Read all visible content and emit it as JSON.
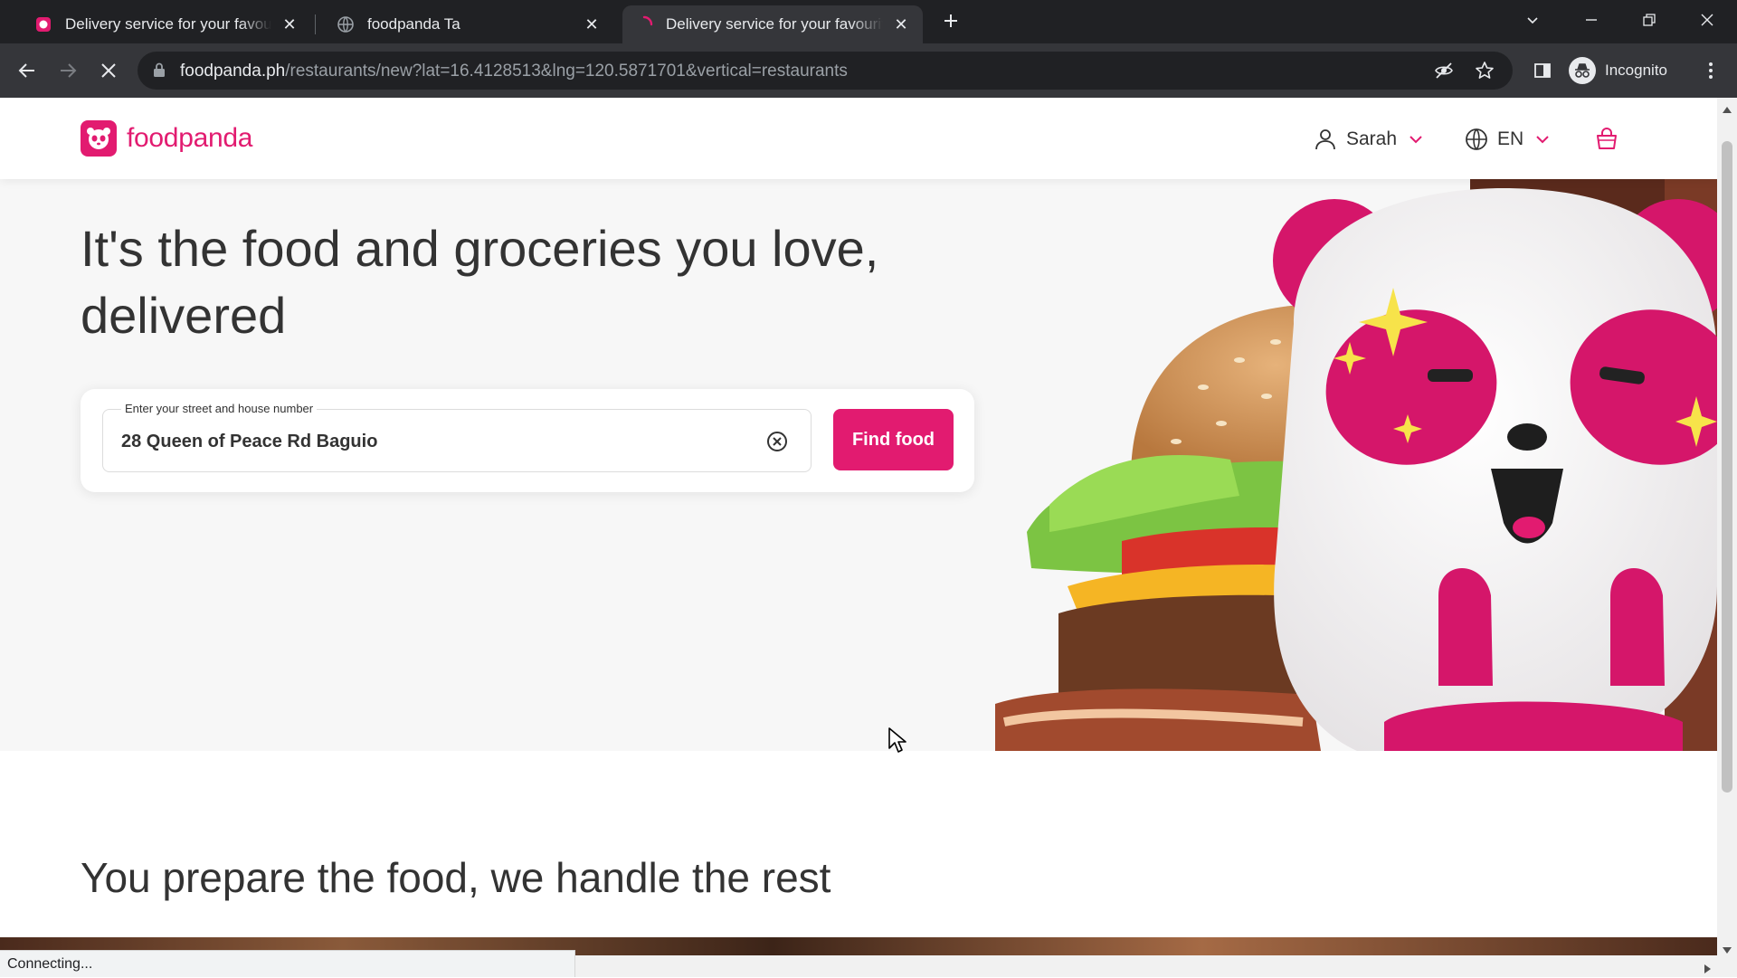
{
  "browser": {
    "tabs": [
      {
        "title": "Delivery service for your favourite restaurants",
        "active": false
      },
      {
        "title": "foodpanda Ta",
        "active": false
      },
      {
        "title": "Delivery service for your favourite restaurants",
        "active": true
      }
    ],
    "url": {
      "host": "foodpanda.ph",
      "path": "/restaurants/new?lat=16.4128513&lng=120.5871701&vertical=restaurants"
    },
    "profile_label": "Incognito",
    "status_text": "Connecting..."
  },
  "header": {
    "logo_text": "foodpanda",
    "user_name": "Sarah",
    "language": "EN"
  },
  "hero": {
    "headline": "It's the food and groceries you love, delivered",
    "address_label": "Enter your street and house number",
    "address_value": "28 Queen of Peace Rd Baguio",
    "find_button": "Find food"
  },
  "section2": {
    "title": "You prepare the food, we handle the rest"
  },
  "colors": {
    "brand": "#e21b70",
    "chrome_dark": "#202124",
    "chrome_toolbar": "#35363a",
    "text": "#333333"
  }
}
